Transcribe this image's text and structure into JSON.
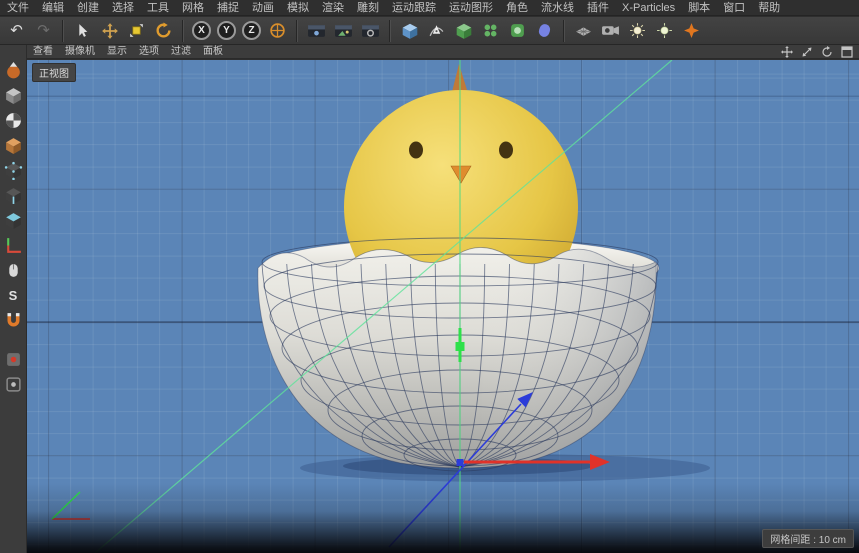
{
  "menubar": {
    "items": [
      "文件",
      "编辑",
      "创建",
      "选择",
      "工具",
      "网格",
      "捕捉",
      "动画",
      "模拟",
      "渲染",
      "雕刻",
      "运动跟踪",
      "运动图形",
      "角色",
      "流水线",
      "插件",
      "X-Particles",
      "脚本",
      "窗口",
      "帮助"
    ]
  },
  "toolbar": {
    "undo_glyph": "↶",
    "redo_glyph": "↷",
    "axis_buttons": [
      "X",
      "Y",
      "Z"
    ],
    "icon_names": [
      "undo-icon",
      "redo-icon",
      "selection-tool-icon",
      "move-tool-icon",
      "scale-tool-icon",
      "rotate-tool-icon",
      "x-axis-toggle-icon",
      "y-axis-toggle-icon",
      "z-axis-toggle-icon",
      "coordinate-system-icon",
      "render-view-icon",
      "render-to-picture-icon",
      "render-settings-icon",
      "primitive-cube-icon",
      "spline-pen-icon",
      "subdivision-surface-icon",
      "generator-icon",
      "volume-icon",
      "deformer-icon",
      "floor-icon",
      "camera-icon",
      "light-icon",
      "light-2-icon",
      "material-star-icon"
    ]
  },
  "left_toolbar": {
    "snap_glyph": "S",
    "icon_names": [
      "make-editable-icon",
      "model-mode-icon",
      "texture-mode-icon",
      "workplane-mode-icon",
      "points-mode-icon",
      "edges-mode-icon",
      "polygons-mode-icon",
      "axis-mode-icon",
      "solo-mode-icon",
      "snap-icon",
      "magnet-icon",
      "keyframe-icon",
      "keyframe-2-icon"
    ]
  },
  "viewport": {
    "menu_items": [
      "查看",
      "摄像机",
      "显示",
      "选项",
      "过滤",
      "面板"
    ],
    "view_label": "正视图",
    "grid_label": "网格间距 : 10 cm",
    "nav_icon_names": [
      "pan-view-icon",
      "zoom-view-icon",
      "rotate-view-icon",
      "toggle-view-icon"
    ],
    "colors": {
      "background": "#5b85b7",
      "axis_x": "#e03229",
      "axis_y": "#2ee04a",
      "axis_z": "#2c3cd9",
      "guide_line": "#5fe39b",
      "chick": "#e4c442",
      "shell": "#d9d9d5"
    }
  }
}
